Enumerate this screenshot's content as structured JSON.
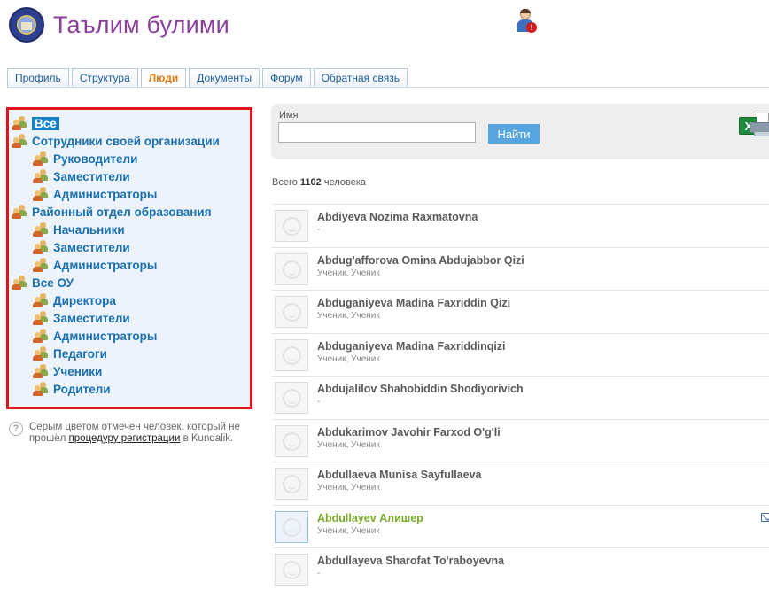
{
  "header": {
    "title": "Таълим булими"
  },
  "tabs": [
    {
      "label": "Профиль"
    },
    {
      "label": "Структура"
    },
    {
      "label": "Люди",
      "active": true
    },
    {
      "label": "Документы"
    },
    {
      "label": "Форум"
    },
    {
      "label": "Обратная связь"
    }
  ],
  "nav": {
    "all": "Все",
    "org": "Сотрудники своей организации",
    "org_heads": "Руководители",
    "org_deputies": "Заместители",
    "org_admins": "Администраторы",
    "district": "Районный отдел образования",
    "district_chiefs": "Начальники",
    "district_deputies": "Заместители",
    "district_admins": "Администраторы",
    "all_ou": "Все ОУ",
    "ou_directors": "Директора",
    "ou_deputies": "Заместители",
    "ou_admins": "Администраторы",
    "ou_teachers": "Педагоги",
    "ou_students": "Ученики",
    "ou_parents": "Родители"
  },
  "help": {
    "text_before": "Серым цветом отмечен человек, который не прошёл ",
    "link": "процедуру регистрации",
    "text_after": " в Kundalik."
  },
  "search": {
    "label": "Имя",
    "value": "",
    "button": "Найти"
  },
  "total": {
    "prefix": "Всего ",
    "count": "1102",
    "suffix": " человека"
  },
  "people": [
    {
      "name": "Abdiyeva Nozima Raxmatovna",
      "role": "-"
    },
    {
      "name": "Abdug'afforova Omina Abdujabbor Qizi",
      "role": "Ученик, Ученик"
    },
    {
      "name": "Abduganiyeva Madina Faxriddin Qizi",
      "role": "Ученик, Ученик"
    },
    {
      "name": "Abduganiyeva Madina Faxriddinqizi",
      "role": "Ученик, Ученик"
    },
    {
      "name": "Abdujalilov Shahobiddin Shodiyorivich",
      "role": "-"
    },
    {
      "name": "Abdukarimov Javohir Farxod O'g'li",
      "role": "Ученик, Ученик"
    },
    {
      "name": "Abdullaeva Munisa Sayfullaeva",
      "role": "Ученик, Ученик"
    },
    {
      "name": "Abdullayev Алишер",
      "role": "Ученик, Ученик",
      "registered": true
    },
    {
      "name": "Abdullayeva Sharofat To'raboyevna",
      "role": "-"
    }
  ]
}
